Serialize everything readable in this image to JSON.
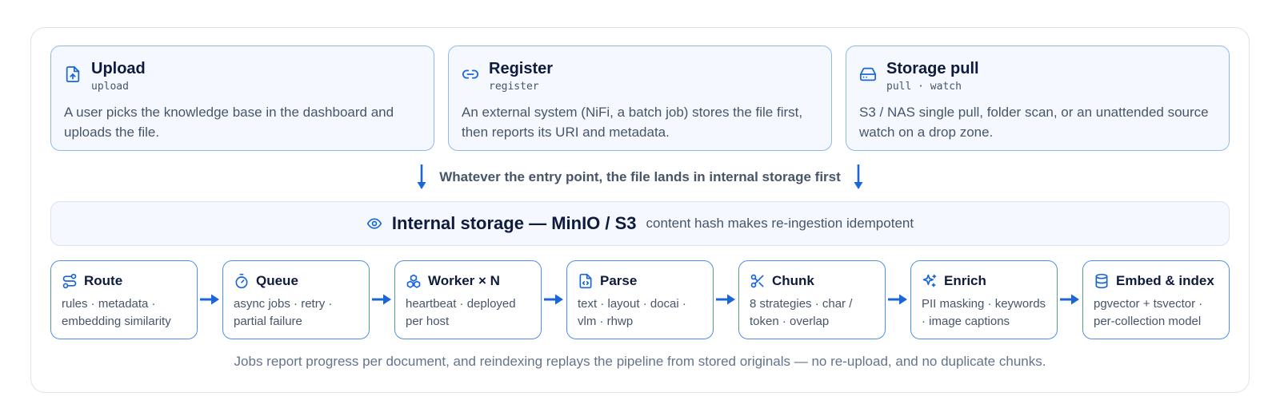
{
  "entries": [
    {
      "title": "Upload",
      "code": "upload",
      "desc": "A user picks the knowledge base in the dashboard and uploads the file.",
      "icon": "file-upload-icon"
    },
    {
      "title": "Register",
      "code": "register",
      "desc": "An external system (NiFi, a batch job) stores the file first, then reports its URI and metadata.",
      "icon": "link-icon"
    },
    {
      "title": "Storage pull",
      "code": "pull · watch",
      "desc": "S3 / NAS single pull, folder scan, or an unattended source watch on a drop zone.",
      "icon": "hard-drive-icon"
    }
  ],
  "flow_note": "Whatever the entry point, the file lands in internal storage first",
  "storage": {
    "title": "Internal storage — MinIO / S3",
    "note": "content hash makes re-ingestion idempotent",
    "icon": "eye-icon"
  },
  "steps": [
    {
      "label": "Route",
      "desc": "rules · metadata · embedding similarity",
      "icon": "route-icon"
    },
    {
      "label": "Queue",
      "desc": "async jobs · retry · partial failure",
      "icon": "timer-icon"
    },
    {
      "label": "Worker × N",
      "desc": "heartbeat · deployed per host",
      "icon": "boxes-icon"
    },
    {
      "label": "Parse",
      "desc": "text · layout · docai · vlm · rhwp",
      "icon": "file-code-icon"
    },
    {
      "label": "Chunk",
      "desc": "8 strategies · char / token · overlap",
      "icon": "scissors-icon"
    },
    {
      "label": "Enrich",
      "desc": "PII masking · keywords · image captions",
      "icon": "sparkles-icon"
    },
    {
      "label": "Embed & index",
      "desc": "pgvector + tsvector · per-collection model",
      "icon": "database-icon"
    }
  ],
  "footer": "Jobs report progress per document, and reindexing replays the pipeline from stored originals — no re-upload, and no duplicate chunks.",
  "colors": {
    "accent": "#1a66d9",
    "card_border": "#8fb8ee",
    "card_bg": "#f5f9ff",
    "text": "#475569",
    "title": "#0f1b3d"
  }
}
